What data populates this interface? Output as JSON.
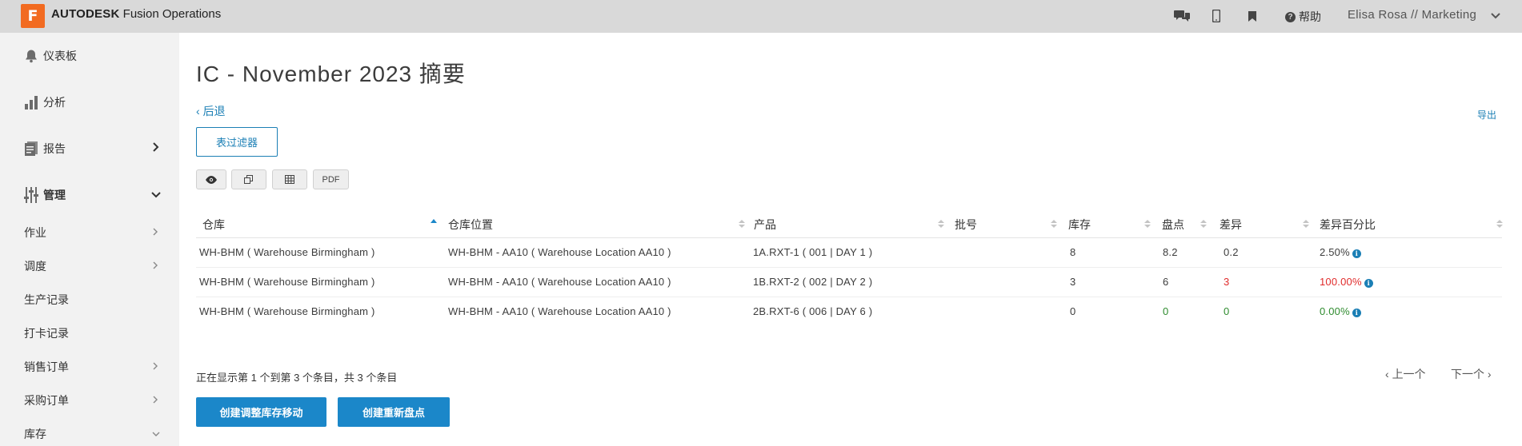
{
  "header": {
    "logo_letter": "F",
    "brand_bold": "AUTODESK",
    "brand_rest": "Fusion Operations",
    "help_label": "帮助",
    "user": "Elisa Rosa // Marketing"
  },
  "sidebar": {
    "main_items": [
      {
        "label": "仪表板"
      },
      {
        "label": "分析"
      },
      {
        "label": "报告"
      },
      {
        "label": "管理"
      }
    ],
    "sub_items": [
      {
        "label": "作业"
      },
      {
        "label": "调度"
      },
      {
        "label": "生产记录"
      },
      {
        "label": "打卡记录"
      },
      {
        "label": "销售订单"
      },
      {
        "label": "采购订单"
      },
      {
        "label": "库存"
      }
    ]
  },
  "main": {
    "title": "IC - November 2023 摘要",
    "back_label": "后退",
    "export_label": "导出",
    "filter_button": "表过滤器",
    "pdf_label": "PDF",
    "showing_text": "正在显示第 1 个到第 3 个条目，共 3 个条目",
    "prev_label": "上一个",
    "next_label": "下一个",
    "create_move_button": "创建调整库存移动",
    "create_recount_button": "创建重新盘点"
  },
  "table": {
    "columns": [
      "仓库",
      "仓库位置",
      "产品",
      "批号",
      "库存",
      "盘点",
      "差异",
      "差异百分比"
    ],
    "rows": [
      {
        "warehouse": "WH-BHM ( Warehouse Birmingham )",
        "location": "WH-BHM - AA10 ( Warehouse Location AA10 )",
        "product": "1A.RXT-1 ( 001 | DAY 1 )",
        "lot": "",
        "stock": "8",
        "count": "8.2",
        "diff": "0.2",
        "pct": "2.50%"
      },
      {
        "warehouse": "WH-BHM ( Warehouse Birmingham )",
        "location": "WH-BHM - AA10 ( Warehouse Location AA10 )",
        "product": "1B.RXT-2 ( 002 | DAY 2 )",
        "lot": "",
        "stock": "3",
        "count": "6",
        "diff": "3",
        "pct": "100.00%"
      },
      {
        "warehouse": "WH-BHM ( Warehouse Birmingham )",
        "location": "WH-BHM - AA10 ( Warehouse Location AA10 )",
        "product": "2B.RXT-6 ( 006 | DAY 6 )",
        "lot": "",
        "stock": "0",
        "count": "0",
        "diff": "0",
        "pct": "0.00%"
      }
    ]
  },
  "colors": {
    "accent": "#1b87c9",
    "link": "#1b7fb5",
    "positive": "#2e8b2e",
    "negative": "#e02b2b",
    "logo": "#f26b21"
  }
}
